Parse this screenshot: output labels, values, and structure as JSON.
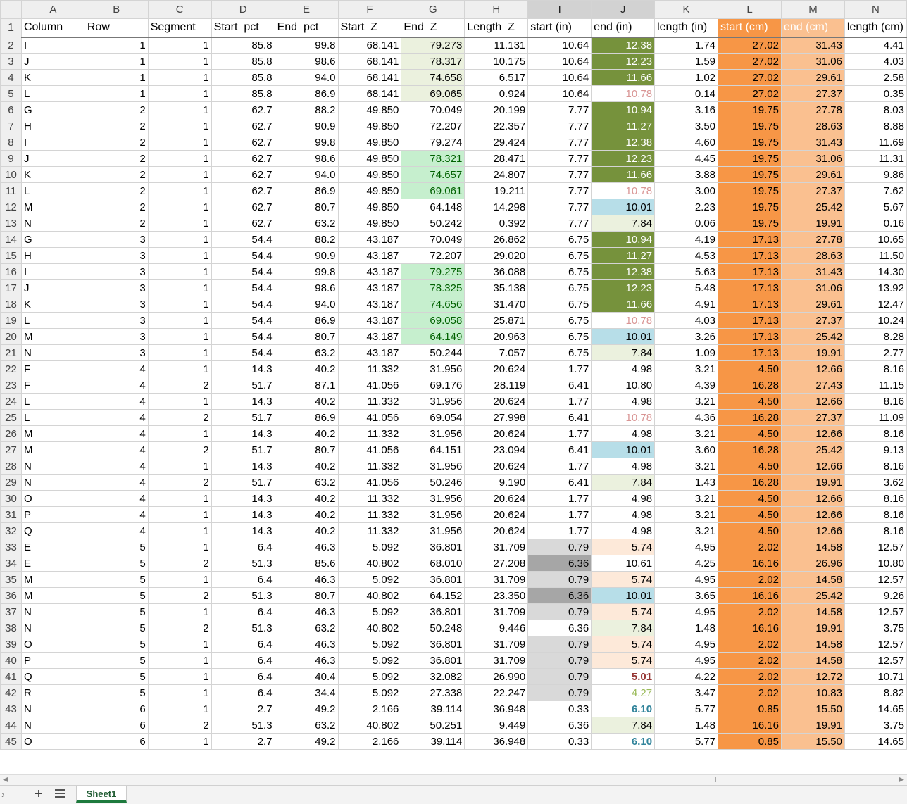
{
  "col_letters": [
    "A",
    "B",
    "C",
    "D",
    "E",
    "F",
    "G",
    "H",
    "I",
    "J",
    "K",
    "L",
    "M",
    "N"
  ],
  "selected_cols": [
    "I",
    "J"
  ],
  "headers": [
    "Column",
    "Row",
    "Segment",
    "Start_pct",
    "End_pct",
    "Start_Z",
    "End_Z",
    "Length_Z",
    "start (in)",
    "end (in)",
    "length (in)",
    "start (cm)",
    "end (cm)",
    "length (cm)"
  ],
  "rows": [
    [
      "I",
      "1",
      "1",
      "85.8",
      "99.8",
      "68.141",
      "79.273",
      "11.131",
      "10.64",
      "12.38",
      "1.74",
      "27.02",
      "31.43",
      "4.41"
    ],
    [
      "J",
      "1",
      "1",
      "85.8",
      "98.6",
      "68.141",
      "78.317",
      "10.175",
      "10.64",
      "12.23",
      "1.59",
      "27.02",
      "31.06",
      "4.03"
    ],
    [
      "K",
      "1",
      "1",
      "85.8",
      "94.0",
      "68.141",
      "74.658",
      "6.517",
      "10.64",
      "11.66",
      "1.02",
      "27.02",
      "29.61",
      "2.58"
    ],
    [
      "L",
      "1",
      "1",
      "85.8",
      "86.9",
      "68.141",
      "69.065",
      "0.924",
      "10.64",
      "10.78",
      "0.14",
      "27.02",
      "27.37",
      "0.35"
    ],
    [
      "G",
      "2",
      "1",
      "62.7",
      "88.2",
      "49.850",
      "70.049",
      "20.199",
      "7.77",
      "10.94",
      "3.16",
      "19.75",
      "27.78",
      "8.03"
    ],
    [
      "H",
      "2",
      "1",
      "62.7",
      "90.9",
      "49.850",
      "72.207",
      "22.357",
      "7.77",
      "11.27",
      "3.50",
      "19.75",
      "28.63",
      "8.88"
    ],
    [
      "I",
      "2",
      "1",
      "62.7",
      "99.8",
      "49.850",
      "79.274",
      "29.424",
      "7.77",
      "12.38",
      "4.60",
      "19.75",
      "31.43",
      "11.69"
    ],
    [
      "J",
      "2",
      "1",
      "62.7",
      "98.6",
      "49.850",
      "78.321",
      "28.471",
      "7.77",
      "12.23",
      "4.45",
      "19.75",
      "31.06",
      "11.31"
    ],
    [
      "K",
      "2",
      "1",
      "62.7",
      "94.0",
      "49.850",
      "74.657",
      "24.807",
      "7.77",
      "11.66",
      "3.88",
      "19.75",
      "29.61",
      "9.86"
    ],
    [
      "L",
      "2",
      "1",
      "62.7",
      "86.9",
      "49.850",
      "69.061",
      "19.211",
      "7.77",
      "10.78",
      "3.00",
      "19.75",
      "27.37",
      "7.62"
    ],
    [
      "M",
      "2",
      "1",
      "62.7",
      "80.7",
      "49.850",
      "64.148",
      "14.298",
      "7.77",
      "10.01",
      "2.23",
      "19.75",
      "25.42",
      "5.67"
    ],
    [
      "N",
      "2",
      "1",
      "62.7",
      "63.2",
      "49.850",
      "50.242",
      "0.392",
      "7.77",
      "7.84",
      "0.06",
      "19.75",
      "19.91",
      "0.16"
    ],
    [
      "G",
      "3",
      "1",
      "54.4",
      "88.2",
      "43.187",
      "70.049",
      "26.862",
      "6.75",
      "10.94",
      "4.19",
      "17.13",
      "27.78",
      "10.65"
    ],
    [
      "H",
      "3",
      "1",
      "54.4",
      "90.9",
      "43.187",
      "72.207",
      "29.020",
      "6.75",
      "11.27",
      "4.53",
      "17.13",
      "28.63",
      "11.50"
    ],
    [
      "I",
      "3",
      "1",
      "54.4",
      "99.8",
      "43.187",
      "79.275",
      "36.088",
      "6.75",
      "12.38",
      "5.63",
      "17.13",
      "31.43",
      "14.30"
    ],
    [
      "J",
      "3",
      "1",
      "54.4",
      "98.6",
      "43.187",
      "78.325",
      "35.138",
      "6.75",
      "12.23",
      "5.48",
      "17.13",
      "31.06",
      "13.92"
    ],
    [
      "K",
      "3",
      "1",
      "54.4",
      "94.0",
      "43.187",
      "74.656",
      "31.470",
      "6.75",
      "11.66",
      "4.91",
      "17.13",
      "29.61",
      "12.47"
    ],
    [
      "L",
      "3",
      "1",
      "54.4",
      "86.9",
      "43.187",
      "69.058",
      "25.871",
      "6.75",
      "10.78",
      "4.03",
      "17.13",
      "27.37",
      "10.24"
    ],
    [
      "M",
      "3",
      "1",
      "54.4",
      "80.7",
      "43.187",
      "64.149",
      "20.963",
      "6.75",
      "10.01",
      "3.26",
      "17.13",
      "25.42",
      "8.28"
    ],
    [
      "N",
      "3",
      "1",
      "54.4",
      "63.2",
      "43.187",
      "50.244",
      "7.057",
      "6.75",
      "7.84",
      "1.09",
      "17.13",
      "19.91",
      "2.77"
    ],
    [
      "F",
      "4",
      "1",
      "14.3",
      "40.2",
      "11.332",
      "31.956",
      "20.624",
      "1.77",
      "4.98",
      "3.21",
      "4.50",
      "12.66",
      "8.16"
    ],
    [
      "F",
      "4",
      "2",
      "51.7",
      "87.1",
      "41.056",
      "69.176",
      "28.119",
      "6.41",
      "10.80",
      "4.39",
      "16.28",
      "27.43",
      "11.15"
    ],
    [
      "L",
      "4",
      "1",
      "14.3",
      "40.2",
      "11.332",
      "31.956",
      "20.624",
      "1.77",
      "4.98",
      "3.21",
      "4.50",
      "12.66",
      "8.16"
    ],
    [
      "L",
      "4",
      "2",
      "51.7",
      "86.9",
      "41.056",
      "69.054",
      "27.998",
      "6.41",
      "10.78",
      "4.36",
      "16.28",
      "27.37",
      "11.09"
    ],
    [
      "M",
      "4",
      "1",
      "14.3",
      "40.2",
      "11.332",
      "31.956",
      "20.624",
      "1.77",
      "4.98",
      "3.21",
      "4.50",
      "12.66",
      "8.16"
    ],
    [
      "M",
      "4",
      "2",
      "51.7",
      "80.7",
      "41.056",
      "64.151",
      "23.094",
      "6.41",
      "10.01",
      "3.60",
      "16.28",
      "25.42",
      "9.13"
    ],
    [
      "N",
      "4",
      "1",
      "14.3",
      "40.2",
      "11.332",
      "31.956",
      "20.624",
      "1.77",
      "4.98",
      "3.21",
      "4.50",
      "12.66",
      "8.16"
    ],
    [
      "N",
      "4",
      "2",
      "51.7",
      "63.2",
      "41.056",
      "50.246",
      "9.190",
      "6.41",
      "7.84",
      "1.43",
      "16.28",
      "19.91",
      "3.62"
    ],
    [
      "O",
      "4",
      "1",
      "14.3",
      "40.2",
      "11.332",
      "31.956",
      "20.624",
      "1.77",
      "4.98",
      "3.21",
      "4.50",
      "12.66",
      "8.16"
    ],
    [
      "P",
      "4",
      "1",
      "14.3",
      "40.2",
      "11.332",
      "31.956",
      "20.624",
      "1.77",
      "4.98",
      "3.21",
      "4.50",
      "12.66",
      "8.16"
    ],
    [
      "Q",
      "4",
      "1",
      "14.3",
      "40.2",
      "11.332",
      "31.956",
      "20.624",
      "1.77",
      "4.98",
      "3.21",
      "4.50",
      "12.66",
      "8.16"
    ],
    [
      "E",
      "5",
      "1",
      "6.4",
      "46.3",
      "5.092",
      "36.801",
      "31.709",
      "0.79",
      "5.74",
      "4.95",
      "2.02",
      "14.58",
      "12.57"
    ],
    [
      "E",
      "5",
      "2",
      "51.3",
      "85.6",
      "40.802",
      "68.010",
      "27.208",
      "6.36",
      "10.61",
      "4.25",
      "16.16",
      "26.96",
      "10.80"
    ],
    [
      "M",
      "5",
      "1",
      "6.4",
      "46.3",
      "5.092",
      "36.801",
      "31.709",
      "0.79",
      "5.74",
      "4.95",
      "2.02",
      "14.58",
      "12.57"
    ],
    [
      "M",
      "5",
      "2",
      "51.3",
      "80.7",
      "40.802",
      "64.152",
      "23.350",
      "6.36",
      "10.01",
      "3.65",
      "16.16",
      "25.42",
      "9.26"
    ],
    [
      "N",
      "5",
      "1",
      "6.4",
      "46.3",
      "5.092",
      "36.801",
      "31.709",
      "0.79",
      "5.74",
      "4.95",
      "2.02",
      "14.58",
      "12.57"
    ],
    [
      "N",
      "5",
      "2",
      "51.3",
      "63.2",
      "40.802",
      "50.248",
      "9.446",
      "6.36",
      "7.84",
      "1.48",
      "16.16",
      "19.91",
      "3.75"
    ],
    [
      "O",
      "5",
      "1",
      "6.4",
      "46.3",
      "5.092",
      "36.801",
      "31.709",
      "0.79",
      "5.74",
      "4.95",
      "2.02",
      "14.58",
      "12.57"
    ],
    [
      "P",
      "5",
      "1",
      "6.4",
      "46.3",
      "5.092",
      "36.801",
      "31.709",
      "0.79",
      "5.74",
      "4.95",
      "2.02",
      "14.58",
      "12.57"
    ],
    [
      "Q",
      "5",
      "1",
      "6.4",
      "40.4",
      "5.092",
      "32.082",
      "26.990",
      "0.79",
      "5.01",
      "4.22",
      "2.02",
      "12.72",
      "10.71"
    ],
    [
      "R",
      "5",
      "1",
      "6.4",
      "34.4",
      "5.092",
      "27.338",
      "22.247",
      "0.79",
      "4.27",
      "3.47",
      "2.02",
      "10.83",
      "8.82"
    ],
    [
      "N",
      "6",
      "1",
      "2.7",
      "49.2",
      "2.166",
      "39.114",
      "36.948",
      "0.33",
      "6.10",
      "5.77",
      "0.85",
      "15.50",
      "14.65"
    ],
    [
      "N",
      "6",
      "2",
      "51.3",
      "63.2",
      "40.802",
      "50.251",
      "9.449",
      "6.36",
      "7.84",
      "1.48",
      "16.16",
      "19.91",
      "3.75"
    ],
    [
      "O",
      "6",
      "1",
      "2.7",
      "49.2",
      "2.166",
      "39.114",
      "36.948",
      "0.33",
      "6.10",
      "5.77",
      "0.85",
      "15.50",
      "14.65"
    ]
  ],
  "colors": {
    "l_fill": "#f79646",
    "m_fill": "#fac090",
    "dark_green": "#76923c",
    "light_green": "#c6efce",
    "pale_green": "#ebf1de",
    "light_blue": "#b7dee8",
    "peach": "#fcd5b4",
    "pale_peach": "#fde9d9",
    "gray_light": "#d9d9d9",
    "gray_dark": "#a6a6a6",
    "text_pinkish": "#d99594",
    "text_green": "#006100",
    "text_olive": "#9bbb59",
    "text_darkred": "#963634",
    "text_teal": "#31849b"
  },
  "sheet_tabs": [
    "Sheet1"
  ],
  "icons": {
    "add_sheet": "plus-icon",
    "all_sheets": "menu-lines-icon",
    "nav": "chevron-right-icon"
  }
}
